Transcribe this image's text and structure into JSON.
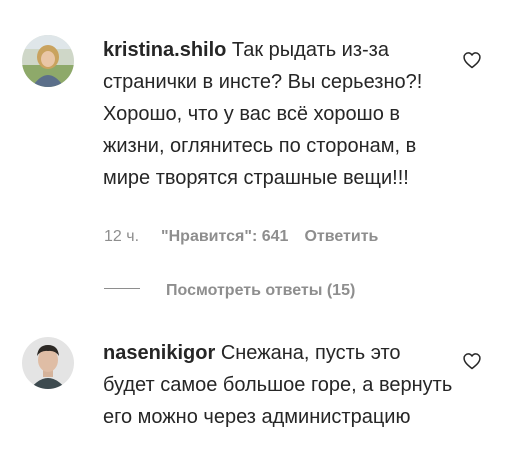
{
  "comments": [
    {
      "username": "kristina.shilo",
      "text": " Так рыдать из-за странички в инсте? Вы серьезно?!Хорошо, что у вас всё хорошо в жизни, оглянитесь по сторонам, в мире творятся страшные вещи!!!",
      "time": "12 ч.",
      "likes": "\"Нравится\": 641",
      "reply_label": "Ответить",
      "view_replies": "Посмотреть ответы (15)"
    },
    {
      "username": "nasenikigor",
      "text": " Снежана, пусть это будет самое большое горе, а вернуть его можно через администрацию"
    }
  ],
  "colors": {
    "text": "#262626",
    "secondary": "#8e8e8e"
  },
  "icons": {
    "like": "heart-outline-icon"
  }
}
